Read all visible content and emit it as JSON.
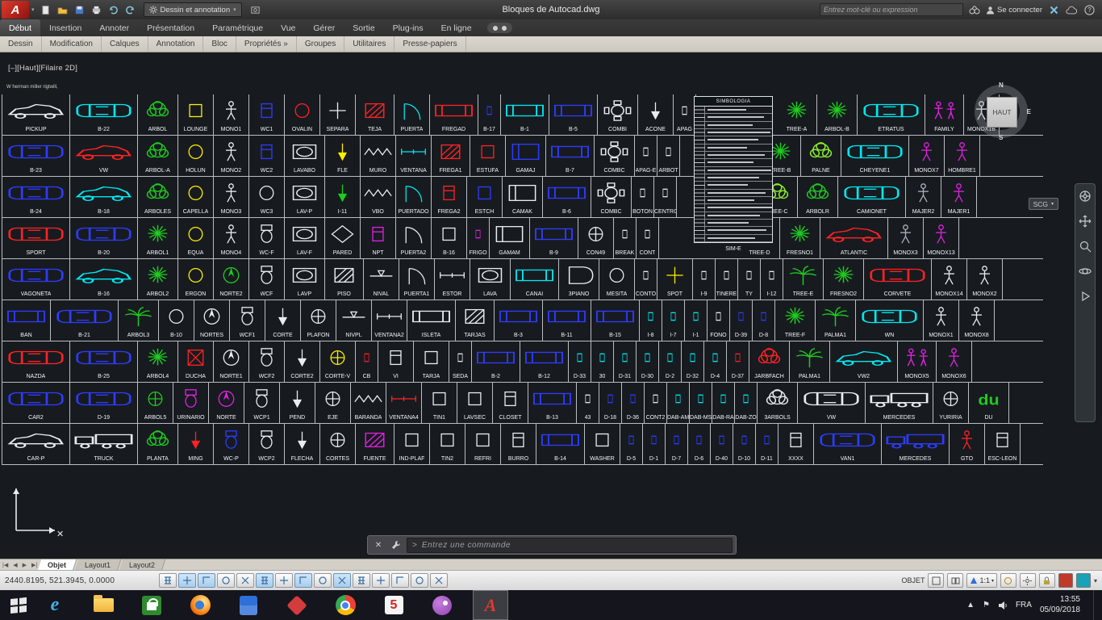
{
  "titlebar": {
    "logo": "A",
    "workspace": "Dessin et annotation",
    "title": "Bloques de Autocad.dwg",
    "search_placeholder": "Entrez mot-clé ou expression",
    "signin": "Se connecter"
  },
  "ribbon": {
    "tabs": [
      "Début",
      "Insertion",
      "Annoter",
      "Présentation",
      "Paramétrique",
      "Vue",
      "Gérer",
      "Sortie",
      "Plug-ins",
      "En ligne"
    ],
    "active_tab": "Début",
    "panels": [
      "Dessin",
      "Modification",
      "Calques",
      "Annotation",
      "Bloc",
      "Propriétés »",
      "Groupes",
      "Utilitaires",
      "Presse-papiers"
    ]
  },
  "canvas": {
    "viewport_label": "[–][Haut][Filaire 2D]",
    "note": "W herman miller rigtwill,",
    "viewcube": {
      "face": "HAUT",
      "north": "N",
      "east": "E",
      "south": "S"
    },
    "nav_dropdown": "SCG",
    "command_placeholder": "Entrez une commande",
    "command_prompt": ">"
  },
  "legend": {
    "title": "SIMBOLOGIA",
    "label": "SIM-E",
    "row_count": 18
  },
  "blocks": {
    "palette": {
      "w": "#e9edf0",
      "c": "#00e8f0",
      "b": "#2e3cff",
      "r": "#ff2222",
      "g": "#1ecb1e",
      "lg": "#8cf02c",
      "m": "#e020e0",
      "y": "#ffee00",
      "gy": "#aab2ba"
    },
    "rows": [
      [
        [
          "PICKUP",
          "carS",
          "w"
        ],
        [
          "B-22",
          "carT",
          "c"
        ],
        [
          "ARBOL",
          "tree2",
          "g"
        ],
        [
          "LOUNGE",
          "sq",
          "y"
        ],
        [
          "MONO1",
          "per",
          "w"
        ],
        [
          "WC1",
          "misc",
          "b"
        ],
        [
          "OVALIN",
          "circ",
          "r"
        ],
        [
          "SEPARA",
          "cross",
          "w"
        ],
        [
          "TEJA",
          "hatch",
          "r"
        ],
        [
          "PUERTA",
          "door",
          "c"
        ],
        [
          "FREGAD",
          "rect",
          "r"
        ],
        [
          "B-17",
          "dot",
          "b"
        ],
        [
          "B-1",
          "rect",
          "c"
        ],
        [
          "B-5",
          "rect",
          "b"
        ],
        [
          "COMBI",
          "table",
          "w"
        ],
        [
          "ACONE",
          "arrow",
          "w"
        ],
        [
          "APAG",
          "dot",
          "w"
        ],
        [
          "",
          "gap",
          "w"
        ],
        [
          "TREE-A",
          "tree",
          "g"
        ],
        [
          "ARBOL-B",
          "tree",
          "g"
        ],
        [
          "ETRATUS",
          "carT",
          "c"
        ],
        [
          "FAMILY",
          "per2",
          "m"
        ],
        [
          "MONOX1B",
          "per",
          "w"
        ]
      ],
      [
        [
          "B-23",
          "carT",
          "b"
        ],
        [
          "VW",
          "carS",
          "r"
        ],
        [
          "ARBOL-A",
          "tree2",
          "g"
        ],
        [
          "HOLUN",
          "circ",
          "y"
        ],
        [
          "MONO2",
          "per",
          "w"
        ],
        [
          "WC2",
          "misc",
          "b"
        ],
        [
          "LAVABO",
          "sink",
          "w"
        ],
        [
          "FLE",
          "arrow",
          "y"
        ],
        [
          "MURO",
          "wall",
          "w"
        ],
        [
          "VENTANA",
          "win",
          "c"
        ],
        [
          "FREGA1",
          "hatch",
          "r"
        ],
        [
          "ESTUFA",
          "sq",
          "r"
        ],
        [
          "GAMAJ",
          "bed",
          "b"
        ],
        [
          "B-7",
          "rect",
          "b"
        ],
        [
          "COMBC",
          "table",
          "w"
        ],
        [
          "APAG-E",
          "dot",
          "w"
        ],
        [
          "ARBOT",
          "dot",
          "w"
        ],
        [
          "",
          "gap",
          "w"
        ],
        [
          "TREE-B",
          "tree",
          "g"
        ],
        [
          "PALNE",
          "tree2",
          "lg"
        ],
        [
          "CHEYENE1",
          "carT",
          "c"
        ],
        [
          "MONOX7",
          "per",
          "m"
        ],
        [
          "HOMBRE1",
          "per",
          "m"
        ]
      ],
      [
        [
          "B-24",
          "carT",
          "b"
        ],
        [
          "B-18",
          "carS",
          "c"
        ],
        [
          "ARBOLES",
          "tree2",
          "g"
        ],
        [
          "CAPELLA",
          "circ",
          "y"
        ],
        [
          "MONO3",
          "per",
          "w"
        ],
        [
          "WC3",
          "circ",
          "w"
        ],
        [
          "LAV-P",
          "sink",
          "w"
        ],
        [
          "I-11",
          "arrow",
          "g"
        ],
        [
          "VBO",
          "wall",
          "w"
        ],
        [
          "PUERTADO",
          "door",
          "c"
        ],
        [
          "FREGA2",
          "misc",
          "r"
        ],
        [
          "ESTCH",
          "sq",
          "b"
        ],
        [
          "CAMAK",
          "bed",
          "w"
        ],
        [
          "B-6",
          "rect",
          "b"
        ],
        [
          "COMBC",
          "table",
          "w"
        ],
        [
          "BOTON",
          "dot",
          "w"
        ],
        [
          "CENTRO",
          "dot",
          "w"
        ],
        [
          "",
          "gap",
          "w"
        ],
        [
          "TREE-C",
          "tree2",
          "lg"
        ],
        [
          "ARBOLR",
          "tree2",
          "g"
        ],
        [
          "CAMIONET",
          "carT",
          "c"
        ],
        [
          "MAJER2",
          "per",
          "gy"
        ],
        [
          "MAJER1",
          "per",
          "m"
        ]
      ],
      [
        [
          "SPORT",
          "carT",
          "r"
        ],
        [
          "B-20",
          "carT",
          "b"
        ],
        [
          "ARBOL1",
          "tree",
          "g"
        ],
        [
          "EQUA",
          "circ",
          "y"
        ],
        [
          "MONO4",
          "per",
          "w"
        ],
        [
          "WC-F",
          "wc",
          "w"
        ],
        [
          "LAV-F",
          "sink",
          "w"
        ],
        [
          "PARED",
          "diam",
          "w"
        ],
        [
          "NPT",
          "misc",
          "m"
        ],
        [
          "PUERTA2",
          "door",
          "w"
        ],
        [
          "B-16",
          "sq",
          "w"
        ],
        [
          "FRIGO",
          "dot",
          "m"
        ],
        [
          "GAMAM",
          "bed",
          "w"
        ],
        [
          "B-9",
          "rect",
          "b"
        ],
        [
          "CON49",
          "circX",
          "w"
        ],
        [
          "BREAK",
          "dot",
          "w"
        ],
        [
          "CONT",
          "dot",
          "w"
        ],
        [
          "",
          "gap",
          "w"
        ],
        [
          "TREE-D",
          "tree",
          "g"
        ],
        [
          "FRESNO1",
          "tree",
          "g"
        ],
        [
          "ATLANTIC",
          "carS",
          "r"
        ],
        [
          "MONOX3",
          "per",
          "gy"
        ],
        [
          "MONOX13",
          "per",
          "m"
        ]
      ],
      [
        [
          "VAGONETA",
          "carT",
          "b"
        ],
        [
          "B-16",
          "carS",
          "c"
        ],
        [
          "ARBOL2",
          "tree",
          "g"
        ],
        [
          "ERGON",
          "circ",
          "y"
        ],
        [
          "NORTE2",
          "north",
          "g"
        ],
        [
          "WCF",
          "wc",
          "w"
        ],
        [
          "LAVP",
          "sink",
          "w"
        ],
        [
          "PISO",
          "hatch",
          "w"
        ],
        [
          "NIVAL",
          "lvl",
          "w"
        ],
        [
          "PUERTA1",
          "door",
          "w"
        ],
        [
          "ESTOR",
          "win",
          "w"
        ],
        [
          "LAVA",
          "sink",
          "w"
        ],
        [
          "CANAI",
          "rect",
          "c"
        ],
        [
          "3PIANO",
          "piano",
          "w"
        ],
        [
          "MESITA",
          "circ",
          "w"
        ],
        [
          "CONTO",
          "dot",
          "w"
        ],
        [
          "SPOT",
          "cross",
          "y"
        ],
        [
          "I-9",
          "dot",
          "w"
        ],
        [
          "TINERE",
          "dot",
          "w"
        ],
        [
          "TY",
          "dot",
          "w"
        ],
        [
          "I-12",
          "dot",
          "w"
        ],
        [
          "TREE-E",
          "palm",
          "g"
        ],
        [
          "FRESNO2",
          "tree",
          "g"
        ],
        [
          "CORVETE",
          "carT",
          "r"
        ],
        [
          "MONOX14",
          "per",
          "w"
        ],
        [
          "MONOX2",
          "per",
          "w"
        ]
      ],
      [
        [
          "BAN",
          "rect",
          "b"
        ],
        [
          "B-21",
          "carT",
          "b"
        ],
        [
          "ARBOL3",
          "palm",
          "g"
        ],
        [
          "B-10",
          "circ",
          "w"
        ],
        [
          "NORTES",
          "north",
          "w"
        ],
        [
          "WCF1",
          "wc",
          "w"
        ],
        [
          "CORTE",
          "arrow",
          "w"
        ],
        [
          "PLAFON",
          "circX",
          "w"
        ],
        [
          "NIVPL",
          "lvl",
          "w"
        ],
        [
          "VENTANA2",
          "win",
          "w"
        ],
        [
          "ISLETA",
          "rect",
          "w"
        ],
        [
          "TARJAS",
          "hatch",
          "w"
        ],
        [
          "B-3",
          "rect",
          "b"
        ],
        [
          "B-11",
          "rect",
          "b"
        ],
        [
          "B-15",
          "rect",
          "b"
        ],
        [
          "I-8",
          "dot",
          "c"
        ],
        [
          "I-7",
          "dot",
          "c"
        ],
        [
          "I-1",
          "dot",
          "c"
        ],
        [
          "FONO",
          "dot",
          "w"
        ],
        [
          "D-39",
          "dot",
          "b"
        ],
        [
          "D-8",
          "dot",
          "b"
        ],
        [
          "TREE-F",
          "tree",
          "g"
        ],
        [
          "PALMA1",
          "palm",
          "g"
        ],
        [
          "WN",
          "carT",
          "c"
        ],
        [
          "MONOX1",
          "per",
          "w"
        ],
        [
          "MONOX8",
          "per",
          "w"
        ]
      ],
      [
        [
          "NAZDA",
          "carT",
          "r"
        ],
        [
          "B-25",
          "carT",
          "b"
        ],
        [
          "ARBOL4",
          "tree",
          "g"
        ],
        [
          "DUCHA",
          "x",
          "r"
        ],
        [
          "NORTE1",
          "north",
          "w"
        ],
        [
          "WCF2",
          "wc",
          "w"
        ],
        [
          "CORTE2",
          "arrow",
          "w"
        ],
        [
          "CORTE-V",
          "circX",
          "y"
        ],
        [
          "CB",
          "dot",
          "r"
        ],
        [
          "VI",
          "misc",
          "w"
        ],
        [
          "TARJA",
          "sq",
          "w"
        ],
        [
          "SEDA",
          "dot",
          "w"
        ],
        [
          "B-2",
          "rect",
          "b"
        ],
        [
          "B-12",
          "rect",
          "b"
        ],
        [
          "D-33",
          "dot",
          "c"
        ],
        [
          "30",
          "dot",
          "c"
        ],
        [
          "D-31",
          "dot",
          "c"
        ],
        [
          "D-30",
          "dot",
          "c"
        ],
        [
          "D-2",
          "dot",
          "c"
        ],
        [
          "D-32",
          "dot",
          "c"
        ],
        [
          "D-4",
          "dot",
          "c"
        ],
        [
          "D-37",
          "dot",
          "r"
        ],
        [
          "JARBFACH",
          "tree2",
          "r"
        ],
        [
          "PALMA1",
          "palm",
          "g"
        ],
        [
          "VW2",
          "carS",
          "c"
        ],
        [
          "MONOX5",
          "per2",
          "m"
        ],
        [
          "MONOX6",
          "per",
          "m"
        ]
      ],
      [
        [
          "CAR2",
          "carT",
          "b"
        ],
        [
          "D-19",
          "carT",
          "b"
        ],
        [
          "ARBOL5",
          "circX",
          "g"
        ],
        [
          "URINARIO",
          "wc",
          "m"
        ],
        [
          "NORTE",
          "north",
          "m"
        ],
        [
          "WCP1",
          "wc",
          "w"
        ],
        [
          "PEND",
          "arrow",
          "w"
        ],
        [
          "EJE",
          "circX",
          "w"
        ],
        [
          "BARANDA",
          "wall",
          "w"
        ],
        [
          "VENTANA4",
          "win",
          "r"
        ],
        [
          "TIN1",
          "sq",
          "w"
        ],
        [
          "LAVSEC",
          "sq",
          "w"
        ],
        [
          "CLOSET",
          "misc",
          "w"
        ],
        [
          "B-13",
          "rect",
          "b"
        ],
        [
          "43",
          "dot",
          "w"
        ],
        [
          "D-18",
          "dot",
          "b"
        ],
        [
          "D-36",
          "dot",
          "b"
        ],
        [
          "CONT2",
          "dot",
          "w"
        ],
        [
          "DAB-AM",
          "dot",
          "c"
        ],
        [
          "DAB-MS",
          "dot",
          "c"
        ],
        [
          "DAB-RA",
          "dot",
          "c"
        ],
        [
          "DAB-ZO",
          "dot",
          "c"
        ],
        [
          "3ARBOLS",
          "tree2",
          "w"
        ],
        [
          "VW",
          "carT",
          "w"
        ],
        [
          "MERCEDES",
          "truck",
          "w"
        ],
        [
          "YURIRIA",
          "circX",
          "w"
        ],
        [
          "DU",
          "txt",
          "g",
          "du"
        ]
      ],
      [
        [
          "CAR-P",
          "carS",
          "w"
        ],
        [
          "TRUCK",
          "truck",
          "w"
        ],
        [
          "PLANTA",
          "tree2",
          "g"
        ],
        [
          "MING",
          "arrow",
          "r"
        ],
        [
          "WC-P",
          "wc",
          "b"
        ],
        [
          "WCP2",
          "wc",
          "w"
        ],
        [
          "FLECHA",
          "arrow",
          "w"
        ],
        [
          "CORTES",
          "circX",
          "w"
        ],
        [
          "FUENTE",
          "hatch",
          "m"
        ],
        [
          "IND-PLAF",
          "sq",
          "w"
        ],
        [
          "TIN2",
          "sq",
          "w"
        ],
        [
          "REFRI",
          "sq",
          "w"
        ],
        [
          "BURRO",
          "misc",
          "w"
        ],
        [
          "B-14",
          "rect",
          "b"
        ],
        [
          "WASHER",
          "sq",
          "w"
        ],
        [
          "D-5",
          "dot",
          "b"
        ],
        [
          "D-1",
          "dot",
          "b"
        ],
        [
          "D-7",
          "dot",
          "b"
        ],
        [
          "D-6",
          "dot",
          "b"
        ],
        [
          "D-40",
          "dot",
          "b"
        ],
        [
          "D-10",
          "dot",
          "b"
        ],
        [
          "D-11",
          "dot",
          "b"
        ],
        [
          "XXXX",
          "misc",
          "w"
        ],
        [
          "VAN1",
          "carT",
          "b"
        ],
        [
          "MERCEDES",
          "truck",
          "b"
        ],
        [
          "GTO",
          "per",
          "r"
        ],
        [
          "ESC-LEON",
          "misc",
          "w"
        ]
      ]
    ]
  },
  "layout_tabs": {
    "items": [
      "Objet",
      "Layout1",
      "Layout2"
    ],
    "active": "Objet"
  },
  "status": {
    "coords": "2440.8195, 521.3945, 0.0000",
    "toggles": [
      "infer",
      "snap",
      "grid",
      "ortho",
      "polar",
      "esnap",
      "esnap3d",
      "otrack",
      "ducs",
      "dyn",
      "lwt",
      "transparency",
      "quickprop",
      "cycling",
      "annomonitor"
    ],
    "active": [
      1,
      2,
      5,
      7,
      9
    ],
    "space": "OBJET",
    "scale": "1:1"
  },
  "navbar": {
    "icons": [
      "steering-wheel",
      "pan-hand",
      "zoom",
      "orbit",
      "show-motion"
    ]
  },
  "taskbar": {
    "apps": [
      "ie",
      "explorer",
      "store",
      "firefox",
      "calculator",
      "app-red",
      "chrome",
      "app-5",
      "paint",
      "autocad"
    ],
    "active_app": "autocad",
    "lang": "FRA",
    "time": "13:55",
    "date": "05/09/2018"
  }
}
